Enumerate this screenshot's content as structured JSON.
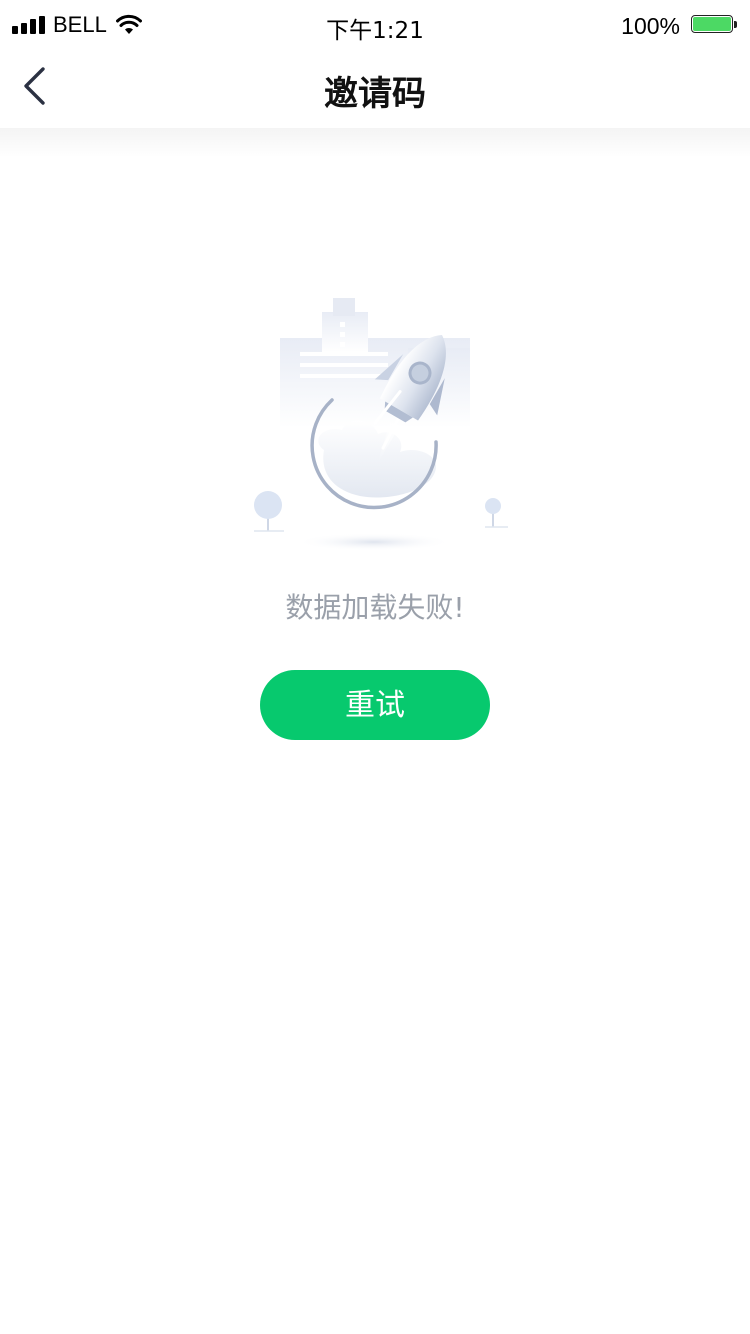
{
  "status_bar": {
    "carrier": "BELL",
    "time": "下午1:21",
    "battery_percent": "100%",
    "battery_level": 1.0,
    "icons": [
      "signal-icon",
      "wifi-icon",
      "battery-icon"
    ]
  },
  "nav": {
    "title": "邀请码",
    "back_icon": "chevron-left-icon"
  },
  "empty_state": {
    "illustration": "rocket-launch-illustration",
    "message": "数据加载失败!",
    "retry_label": "重试"
  },
  "colors": {
    "accent": "#07c96e",
    "message_text": "#9aa0aa",
    "battery_fill": "#4cd964"
  }
}
